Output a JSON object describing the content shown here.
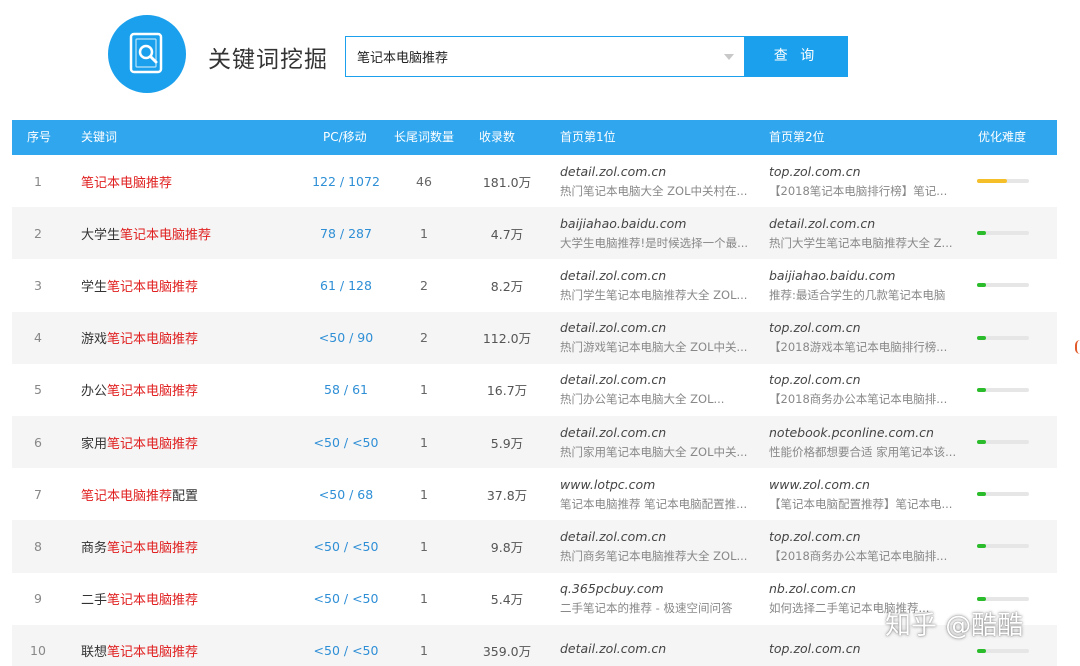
{
  "app": {
    "title": "关键词挖掘"
  },
  "search": {
    "value": "笔记本电脑推荐",
    "button": "查 询"
  },
  "colors": {
    "accent": "#1aa0ec",
    "header": "#2fa6ee",
    "keyword_highlight": "#e02020",
    "bar_high": "#f5bf2a",
    "bar_low": "#2bbc2b"
  },
  "table": {
    "headers": {
      "idx": "序号",
      "keyword": "关键词",
      "pc_mobile": "PC/移动",
      "longtail": "长尾词数量",
      "indexed": "收录数",
      "pos1": "首页第1位",
      "pos2": "首页第2位",
      "difficulty": "优化难度"
    },
    "rows": [
      {
        "idx": "1",
        "kw_pre": "",
        "kw_hl": "笔记本电脑推荐",
        "kw_post": "",
        "pc": "122 / 1072",
        "tail": "46",
        "rec": "181.0万",
        "p1_domain": "detail.zol.com.cn",
        "p1_snip": "热门笔记本电脑大全 ZOL中关村在...",
        "p2_domain": "top.zol.com.cn",
        "p2_snip": "【2018笔记本电脑排行榜】笔记...",
        "difficulty": 0.58
      },
      {
        "idx": "2",
        "kw_pre": "大学生",
        "kw_hl": "笔记本电脑推荐",
        "kw_post": "",
        "pc": "78 / 287",
        "tail": "1",
        "rec": "4.7万",
        "p1_domain": "baijiahao.baidu.com",
        "p1_snip": "大学生电脑推荐!是时候选择一个最...",
        "p2_domain": "detail.zol.com.cn",
        "p2_snip": "热门大学生笔记本电脑推荐大全 Z...",
        "difficulty": 0.17
      },
      {
        "idx": "3",
        "kw_pre": "学生",
        "kw_hl": "笔记本电脑推荐",
        "kw_post": "",
        "pc": "61 / 128",
        "tail": "2",
        "rec": "8.2万",
        "p1_domain": "detail.zol.com.cn",
        "p1_snip": "热门学生笔记本电脑推荐大全 ZOL...",
        "p2_domain": "baijiahao.baidu.com",
        "p2_snip": "推荐:最适合学生的几款笔记本电脑",
        "difficulty": 0.17
      },
      {
        "idx": "4",
        "kw_pre": "游戏",
        "kw_hl": "笔记本电脑推荐",
        "kw_post": "",
        "pc": "<50 / 90",
        "tail": "2",
        "rec": "112.0万",
        "p1_domain": "detail.zol.com.cn",
        "p1_snip": "热门游戏笔记本电脑大全 ZOL中关...",
        "p2_domain": "top.zol.com.cn",
        "p2_snip": "【2018游戏本笔记本电脑排行榜...",
        "difficulty": 0.17
      },
      {
        "idx": "5",
        "kw_pre": "办公",
        "kw_hl": "笔记本电脑推荐",
        "kw_post": "",
        "pc": "58 / 61",
        "tail": "1",
        "rec": "16.7万",
        "p1_domain": "detail.zol.com.cn",
        "p1_snip": "热门办公笔记本电脑大全 ZOL...",
        "p2_domain": "top.zol.com.cn",
        "p2_snip": "【2018商务办公本笔记本电脑排...",
        "difficulty": 0.17
      },
      {
        "idx": "6",
        "kw_pre": "家用",
        "kw_hl": "笔记本电脑推荐",
        "kw_post": "",
        "pc": "<50 / <50",
        "tail": "1",
        "rec": "5.9万",
        "p1_domain": "detail.zol.com.cn",
        "p1_snip": "热门家用笔记本电脑大全 ZOL中关...",
        "p2_domain": "notebook.pconline.com.cn",
        "p2_snip": "性能价格都想要合适 家用笔记本该...",
        "difficulty": 0.17
      },
      {
        "idx": "7",
        "kw_pre": "",
        "kw_hl": "笔记本电脑推荐",
        "kw_post": "配置",
        "pc": "<50 / 68",
        "tail": "1",
        "rec": "37.8万",
        "p1_domain": "www.lotpc.com",
        "p1_snip": "笔记本电脑推荐 笔记本电脑配置推...",
        "p2_domain": "www.zol.com.cn",
        "p2_snip": "【笔记本电脑配置推荐】笔记本电...",
        "difficulty": 0.17
      },
      {
        "idx": "8",
        "kw_pre": "商务",
        "kw_hl": "笔记本电脑推荐",
        "kw_post": "",
        "pc": "<50 / <50",
        "tail": "1",
        "rec": "9.8万",
        "p1_domain": "detail.zol.com.cn",
        "p1_snip": "热门商务笔记本电脑推荐大全 ZOL...",
        "p2_domain": "top.zol.com.cn",
        "p2_snip": "【2018商务办公本笔记本电脑排...",
        "difficulty": 0.17
      },
      {
        "idx": "9",
        "kw_pre": "二手",
        "kw_hl": "笔记本电脑推荐",
        "kw_post": "",
        "pc": "<50 / <50",
        "tail": "1",
        "rec": "5.4万",
        "p1_domain": "q.365pcbuy.com",
        "p1_snip": "二手笔记本的推荐 - 极速空间问答",
        "p2_domain": "nb.zol.com.cn",
        "p2_snip": "如何选择二手笔记本电脑推荐...",
        "difficulty": 0.17
      },
      {
        "idx": "10",
        "kw_pre": "联想",
        "kw_hl": "笔记本电脑推荐",
        "kw_post": "",
        "pc": "<50 / <50",
        "tail": "1",
        "rec": "359.0万",
        "p1_domain": "detail.zol.com.cn",
        "p1_snip": "",
        "p2_domain": "top.zol.com.cn",
        "p2_snip": "",
        "difficulty": 0.17
      }
    ]
  },
  "watermark": "知乎 @酷酷"
}
